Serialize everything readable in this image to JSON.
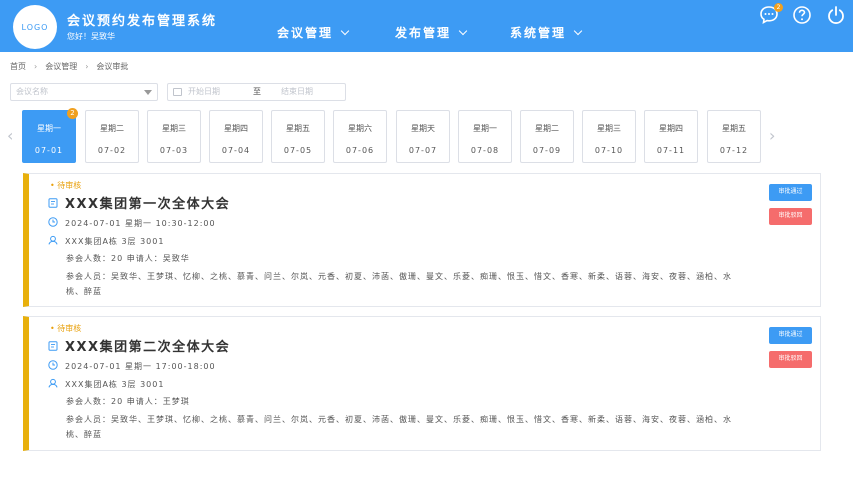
{
  "header": {
    "logo_text": "LOGO",
    "title": "会议预约发布管理系统",
    "greeting": "您好！吴致华",
    "nav": [
      {
        "label": "会议管理"
      },
      {
        "label": "发布管理"
      },
      {
        "label": "系统管理"
      }
    ],
    "message_badge": "2",
    "colors": {
      "primary": "#3d9bf4",
      "pending": "#e8b00c",
      "reject": "#f56c6c"
    }
  },
  "breadcrumb": [
    "首页",
    "会议管理",
    "会议审批"
  ],
  "filters": {
    "meeting_name_placeholder": "会议名称",
    "start_placeholder": "开始日期",
    "range_separator": "至",
    "end_placeholder": "结束日期"
  },
  "days": [
    {
      "weekday": "星期一",
      "date": "07-01",
      "badge": "2",
      "active": true
    },
    {
      "weekday": "星期二",
      "date": "07-02"
    },
    {
      "weekday": "星期三",
      "date": "07-03"
    },
    {
      "weekday": "星期四",
      "date": "07-04"
    },
    {
      "weekday": "星期五",
      "date": "07-05"
    },
    {
      "weekday": "星期六",
      "date": "07-06"
    },
    {
      "weekday": "星期天",
      "date": "07-07"
    },
    {
      "weekday": "星期一",
      "date": "07-08"
    },
    {
      "weekday": "星期二",
      "date": "07-09"
    },
    {
      "weekday": "星期三",
      "date": "07-10"
    },
    {
      "weekday": "星期四",
      "date": "07-11"
    },
    {
      "weekday": "星期五",
      "date": "07-12"
    }
  ],
  "meetings": [
    {
      "status": "• 待审核",
      "title": "XXX集团第一次全体大会",
      "datetime": "2024-07-01  星期一  10:30-12:00",
      "location": "XXX集团A栋 3层 3001",
      "count_line": "参会人数：20      申请人：吴致华",
      "attendees": "参会人员：吴致华、王梦琪、忆柳、之桃、慕青、问兰、尔岚、元香、初夏、沛菡、傲珊、曼文、乐菱、痴珊、恨玉、惜文、香寒、新柔、语蓉、海安、夜蓉、涵柏、水桃、醉蓝",
      "approve_label": "审批通过",
      "reject_label": "审批驳回"
    },
    {
      "status": "• 待审核",
      "title": "XXX集团第二次全体大会",
      "datetime": "2024-07-01  星期一  17:00-18:00",
      "location": "XXX集团A栋 3层 3001",
      "count_line": "参会人数：20      申请人：王梦琪",
      "attendees": "参会人员：吴致华、王梦琪、忆柳、之桃、慕青、问兰、尔岚、元香、初夏、沛菡、傲珊、曼文、乐菱、痴珊、恨玉、惜文、香寒、新柔、语蓉、海安、夜蓉、涵柏、水桃、醉蓝",
      "approve_label": "审批通过",
      "reject_label": "审批驳回"
    }
  ]
}
